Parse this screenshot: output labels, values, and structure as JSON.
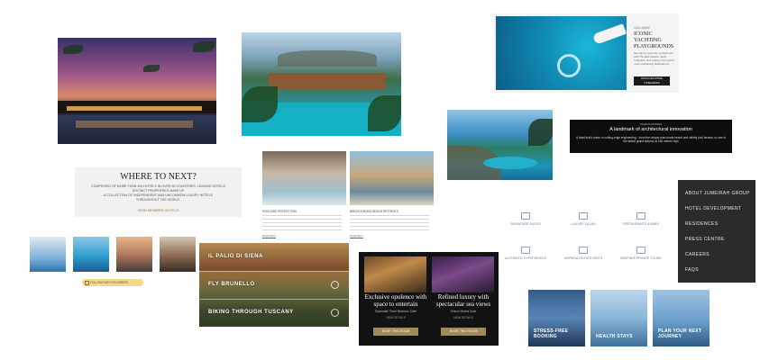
{
  "where_to_next": {
    "title": "WHERE TO NEXT?",
    "line1": "COMPRISED OF MORE THAN 490 HOTELS IN OVER 60 COUNTRIES, LEADING HOTELS",
    "line2": "DISTINCT PROPERTIES MAKE UP",
    "line3": "A COLLECTION OF INDEPENDENT AND UNCOMMON LUXURY HOTELS",
    "line4": "THROUGHOUT THE WORLD.",
    "link": "VIEW MEMBER HOTELS"
  },
  "yachting": {
    "eyebrow": "SAIL AWAY",
    "title": "ICONIC YACHTING PLAYGROUNDS",
    "body": "Set sail on a journey of discovery with The Ritz-Carlton Yacht Collection and explore the world's most enchanting destinations.",
    "button": "DISCOVER MORE ITINERARIES"
  },
  "architecture": {
    "eyebrow": "ATHENS RIVIERA",
    "title": "A landmark of architectural innovation",
    "body": "A hotel that's home to cutting-edge engineering – from the unique man-made beach and infinity pool terrace, to one of the tallest grand atriums at 180 metres high"
  },
  "jumeirah_menu": {
    "items": [
      "ABOUT JUMEIRAH GROUP",
      "HOTEL DEVELOPMENT",
      "RESIDENCES",
      "PRESS CENTRE",
      "CAREERS",
      "FAQS"
    ]
  },
  "villas": {
    "left_title": "POOLSIDE PERFECTION",
    "right_title": "BREATHTAKING BEACH RETREATS",
    "left_link": "Read More",
    "right_link": "Read More"
  },
  "features": {
    "items": [
      "SIGNATURE SUITES",
      "LUXURY VILLAS",
      "RESTAURANTS & BARS",
      "AUTHENTIC EXPERIENCES",
      "UNPARALLELED EVENTS",
      "BESPOKE PRIVATE TOURS"
    ]
  },
  "tuscany": {
    "items": [
      "IL PALIO DI SIENA",
      "FLY BRUNELLO",
      "BIKING THROUGH TUSCANY"
    ]
  },
  "opulence": {
    "left_title": "Exclusive opulence with space to entertain",
    "left_sub": "Diplomatic Three Bedroom Suite",
    "left_link": "VIEW DETAILS",
    "left_button": "BOOK THIS ROOM",
    "right_title": "Refined luxury with spectacular sea views",
    "right_sub": "Deluxe Marina Suite",
    "right_link": "VIEW DETAILS",
    "right_button": "BOOK THIS ROOM"
  },
  "tiles": {
    "items": [
      "STRESS-FREE BOOKING",
      "HEALTH STAYS",
      "PLAN YOUR NEXT JOURNEY"
    ]
  },
  "explore_pill": "FOLLOW OUR EXPLORERS"
}
